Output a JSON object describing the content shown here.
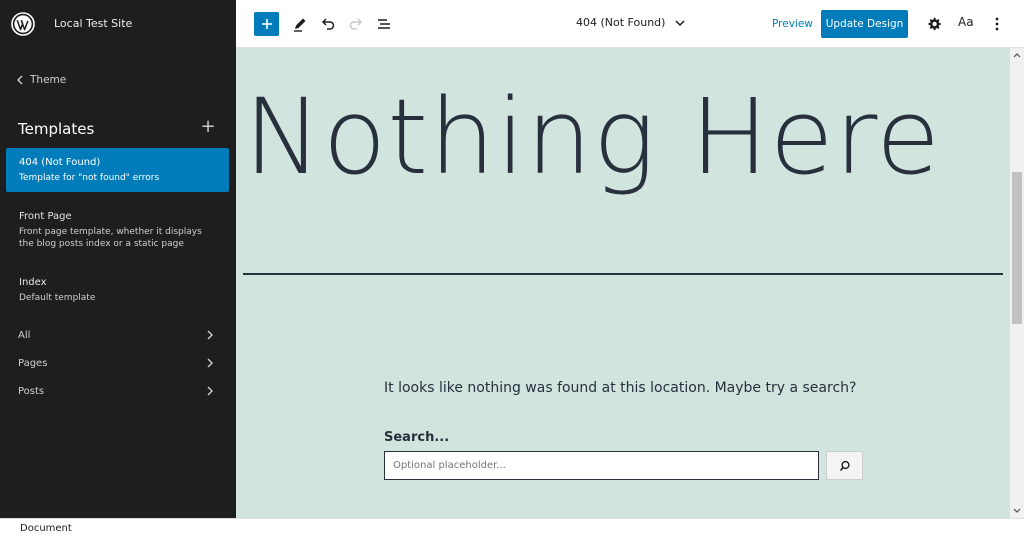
{
  "site": {
    "title": "Local Test Site"
  },
  "sidebar": {
    "back_label": "Theme",
    "section_title": "Templates",
    "templates": [
      {
        "name": "404 (Not Found)",
        "description": "Template for \"not found\" errors",
        "active": true
      },
      {
        "name": "Front Page",
        "description": "Front page template, whether it displays the blog posts index or a static page",
        "active": false
      },
      {
        "name": "Index",
        "description": "Default template",
        "active": false
      }
    ],
    "nav": [
      {
        "label": "All"
      },
      {
        "label": "Pages"
      },
      {
        "label": "Posts"
      }
    ]
  },
  "toolbar": {
    "document_title": "404 (Not Found)",
    "preview_label": "Preview",
    "update_label": "Update Design",
    "styles_label": "Aa"
  },
  "canvas": {
    "title": "Nothing Here",
    "message": "It looks like nothing was found at this location. Maybe try a search?",
    "search_label": "Search...",
    "search_placeholder": "Optional placeholder..."
  },
  "footer": {
    "breadcrumb": "Document"
  },
  "colors": {
    "sidebar_bg": "#1e1e1e",
    "accent": "#007cba",
    "canvas_bg": "#d1e4dd",
    "text_dark": "#28303d"
  }
}
